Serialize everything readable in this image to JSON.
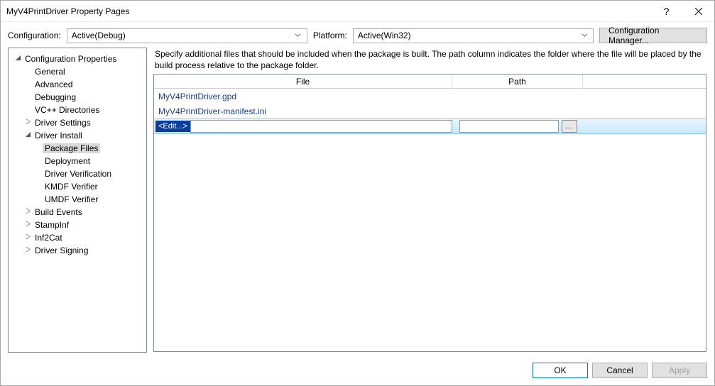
{
  "window": {
    "title": "MyV4PrintDriver Property Pages"
  },
  "titlebar": {
    "help_label": "?",
    "close_label": "Close"
  },
  "top": {
    "config_label": "Configuration:",
    "config_value": "Active(Debug)",
    "platform_label": "Platform:",
    "platform_value": "Active(Win32)",
    "config_mgr_label": "Configuration Manager..."
  },
  "tree": {
    "items": [
      {
        "label": "Configuration Properties",
        "level": 0,
        "expander": "open"
      },
      {
        "label": "General",
        "level": 1,
        "expander": "none"
      },
      {
        "label": "Advanced",
        "level": 1,
        "expander": "none"
      },
      {
        "label": "Debugging",
        "level": 1,
        "expander": "none"
      },
      {
        "label": "VC++ Directories",
        "level": 1,
        "expander": "none"
      },
      {
        "label": "Driver Settings",
        "level": 1,
        "expander": "closed"
      },
      {
        "label": "Driver Install",
        "level": 1,
        "expander": "open"
      },
      {
        "label": "Package Files",
        "level": 2,
        "expander": "none",
        "selected": true
      },
      {
        "label": "Deployment",
        "level": 2,
        "expander": "none"
      },
      {
        "label": "Driver Verification",
        "level": 2,
        "expander": "none"
      },
      {
        "label": "KMDF Verifier",
        "level": 2,
        "expander": "none"
      },
      {
        "label": "UMDF Verifier",
        "level": 2,
        "expander": "none"
      },
      {
        "label": "Build Events",
        "level": 1,
        "expander": "closed"
      },
      {
        "label": "StampInf",
        "level": 1,
        "expander": "closed"
      },
      {
        "label": "Inf2Cat",
        "level": 1,
        "expander": "closed"
      },
      {
        "label": "Driver Signing",
        "level": 1,
        "expander": "closed"
      }
    ]
  },
  "right": {
    "description": "Specify additional files that should be included when the package is built.  The path column indicates the folder where the file will be placed by the build process relative to the package folder.",
    "columns": {
      "file": "File",
      "path": "Path"
    },
    "rows": [
      {
        "file": "MyV4PrintDriver.gpd",
        "path": ""
      },
      {
        "file": "MyV4PrintDriver-manifest.ini",
        "path": ""
      }
    ],
    "edit_placeholder": "<Edit...>",
    "browse_label": "..."
  },
  "footer": {
    "ok_label": "OK",
    "cancel_label": "Cancel",
    "apply_label": "Apply"
  }
}
